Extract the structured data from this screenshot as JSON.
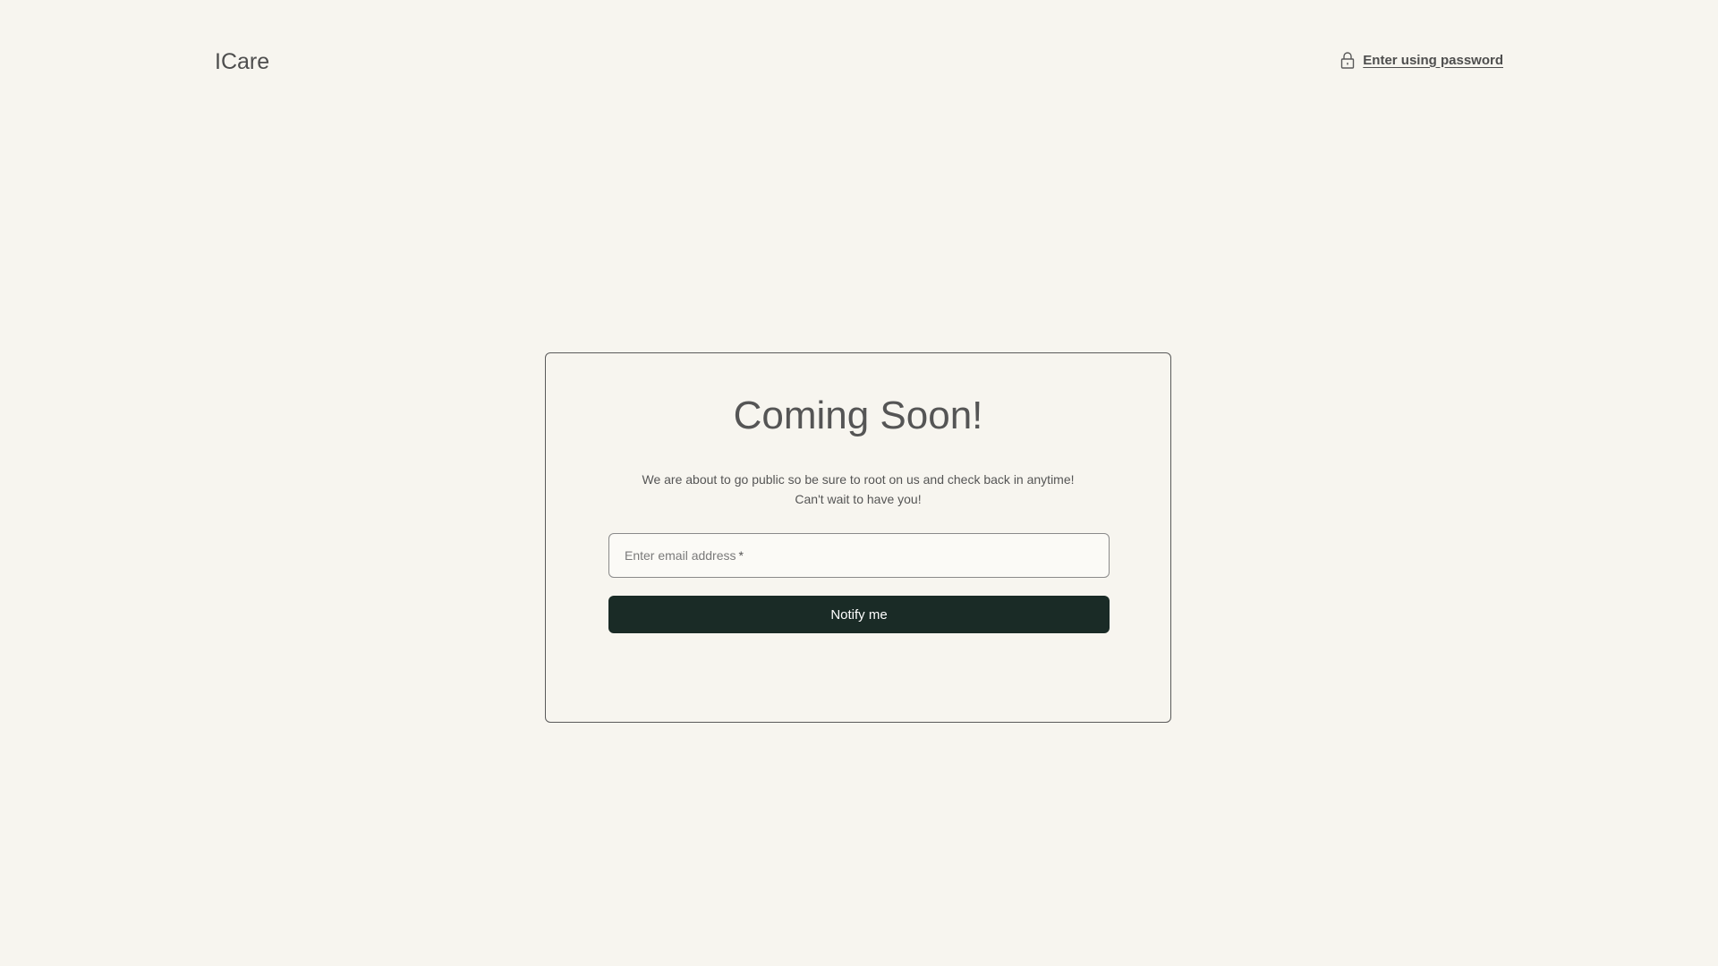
{
  "header": {
    "brand": "ICare",
    "password_link": "Enter using password",
    "password_icon": "lock-icon"
  },
  "card": {
    "title": "Coming Soon!",
    "description_line1": "We are about to go public so be sure to root on us and check back in anytime!",
    "description_line2": "Can't wait to have you!",
    "email_placeholder": "Enter email address",
    "email_required_mark": "*",
    "email_value": "",
    "button_label": "Notify me"
  },
  "colors": {
    "background": "#f7f5ef",
    "button": "#1a2b26",
    "text": "#555555"
  }
}
